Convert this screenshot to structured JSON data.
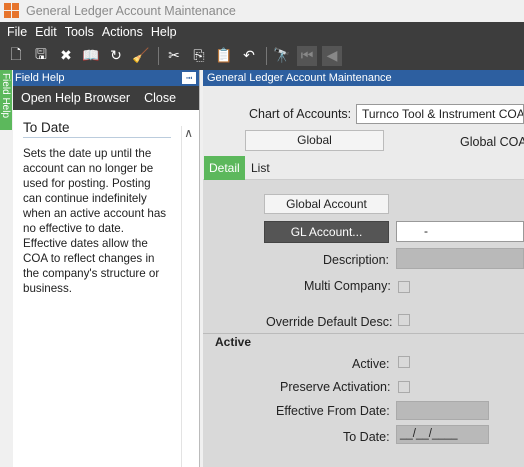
{
  "window": {
    "title": "General Ledger Account Maintenance"
  },
  "menu": [
    "File",
    "Edit",
    "Tools",
    "Actions",
    "Help"
  ],
  "toolbar": {
    "icons": [
      "new-icon",
      "save-icon",
      "delete-icon",
      "library-icon",
      "refresh-icon",
      "clear-icon",
      "cut-icon",
      "copy-icon",
      "paste-icon",
      "undo-icon",
      "binoculars-icon",
      "first-record-icon",
      "previous-record-icon"
    ]
  },
  "side_tab": {
    "label": "Field Help"
  },
  "help": {
    "panel_title": "Field Help",
    "open_browser": "Open Help Browser",
    "close": "Close",
    "topic_title": "To Date",
    "topic_text": "Sets the date up until the account can no longer be used for posting. Posting can continue indefinitely when an active account has no effective to date. Effective dates allow the COA to reflect changes in the company's structure or business."
  },
  "main": {
    "panel_title": "General Ledger Account Maintenance",
    "chart_of_accounts_label": "Chart of Accounts:",
    "chart_of_accounts_value": "Turnco Tool & Instrument COA",
    "global_button": "Global",
    "global_coa_label": "Global COA",
    "tabs": [
      "Detail",
      "List"
    ],
    "global_account_button": "Global Account",
    "gl_account_button": "GL Account...",
    "gl_account_value": "-",
    "description_label": "Description:",
    "multi_company_label": "Multi Company:",
    "override_desc_label": "Override Default Desc:",
    "active_section": "Active",
    "active_label": "Active:",
    "preserve_activation_label": "Preserve Activation:",
    "effective_from_label": "Effective From Date:",
    "to_date_label": "To Date:",
    "to_date_value": "__/__/____"
  }
}
